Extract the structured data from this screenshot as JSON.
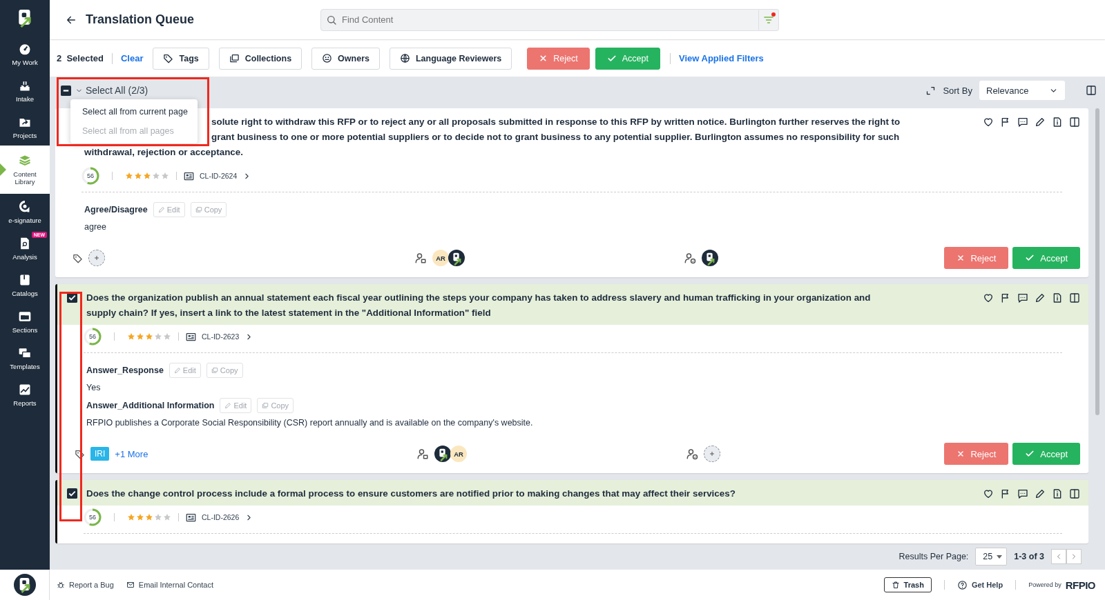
{
  "sidebar": {
    "items": [
      {
        "label": "My Work",
        "selected": false
      },
      {
        "label": "Intake",
        "selected": false
      },
      {
        "label": "Projects",
        "selected": false
      },
      {
        "label": "Content Library",
        "selected": true
      },
      {
        "label": "e-signature",
        "selected": false
      },
      {
        "label": "Analysis",
        "selected": false,
        "badge": "NEW"
      },
      {
        "label": "Catalogs",
        "selected": false
      },
      {
        "label": "Sections",
        "selected": false
      },
      {
        "label": "Templates",
        "selected": false
      },
      {
        "label": "Reports",
        "selected": false
      }
    ]
  },
  "header": {
    "title": "Translation Queue",
    "search": {
      "placeholder": "Find Content"
    },
    "filter_active": true
  },
  "toolbar": {
    "count": "2",
    "count_label": "Selected",
    "clear": "Clear",
    "filters": [
      "Tags",
      "Collections",
      "Owners",
      "Language Reviewers"
    ],
    "reject": "Reject",
    "accept": "Accept",
    "view_filters": "View Applied Filters"
  },
  "list_header": {
    "select_all": "Select All (2/3)",
    "select_all_indeterminate": true,
    "menu": [
      {
        "label": "Select all from current page",
        "disabled": false
      },
      {
        "label": "Select all from all pages",
        "disabled": true
      }
    ],
    "sort_label": "Sort By",
    "sort_value": "Relevance"
  },
  "cards": [
    {
      "selected": false,
      "question_lines": [
        {
          "text": "solute right to withdraw this RFP or to reject any or all proposals submitted in response to this RFP by written notice. Burlington further reserves the right to",
          "covered": true
        },
        {
          "text": "grant business to one or more potential suppliers or to decide not to grant business to any potential supplier. Burlington assumes no responsibility for such",
          "covered": true
        },
        {
          "text": "withdrawal, rejection or acceptance.",
          "covered": false
        }
      ],
      "score": "56",
      "level": 0.56,
      "stars": 3,
      "id": "CL-ID-2624",
      "answers": [
        {
          "label": "Agree/Disagree",
          "edit": "Edit",
          "copy": "Copy",
          "value": "agree"
        }
      ],
      "owners": [
        {
          "kind": "initials",
          "text": "AR"
        },
        {
          "kind": "logo"
        }
      ],
      "reviewers": [
        {
          "kind": "logo"
        }
      ],
      "reject": "Reject",
      "accept": "Accept"
    },
    {
      "selected": true,
      "question_lines": [
        {
          "text": "Does the organization publish an annual statement each fiscal year outlining the steps your company has taken to address slavery and human trafficking in your organization and",
          "covered": false
        },
        {
          "text": "supply chain? If yes, insert a link to the latest statement in the \"Additional Information\" field",
          "covered": false
        }
      ],
      "score": "56",
      "level": 0.56,
      "stars": 3,
      "id": "CL-ID-2623",
      "answers": [
        {
          "label": "Answer_Response",
          "edit": "Edit",
          "copy": "Copy",
          "value": "Yes"
        },
        {
          "label": "Answer_Additional Information",
          "edit": "Edit",
          "copy": "Copy",
          "value": "RFPIO publishes a Corporate Social Responsibility (CSR) report annually and is available on the company's website."
        }
      ],
      "tags": [
        {
          "label": "IRI",
          "color": "#29b5e8"
        }
      ],
      "more": "+1 More",
      "owners": [
        {
          "kind": "logo"
        },
        {
          "kind": "initials",
          "text": "AR"
        }
      ],
      "reviewers": [
        {
          "kind": "add"
        }
      ],
      "reject": "Reject",
      "accept": "Accept"
    },
    {
      "selected": true,
      "question_lines": [
        {
          "text": "Does the change control process include a formal process to ensure customers are notified prior to making changes that may affect their services?",
          "covered": false
        }
      ],
      "score": "56",
      "level": 0.56,
      "stars": 3,
      "id": "CL-ID-2626"
    }
  ],
  "pager": {
    "label": "Results Per Page:",
    "per_page": "25",
    "range": "1-3 of 3"
  },
  "footer": {
    "report": "Report a Bug",
    "email": "Email Internal Contact",
    "trash": "Trash",
    "help": "Get Help",
    "powered": "Powered by",
    "brand": "RFPIO"
  }
}
